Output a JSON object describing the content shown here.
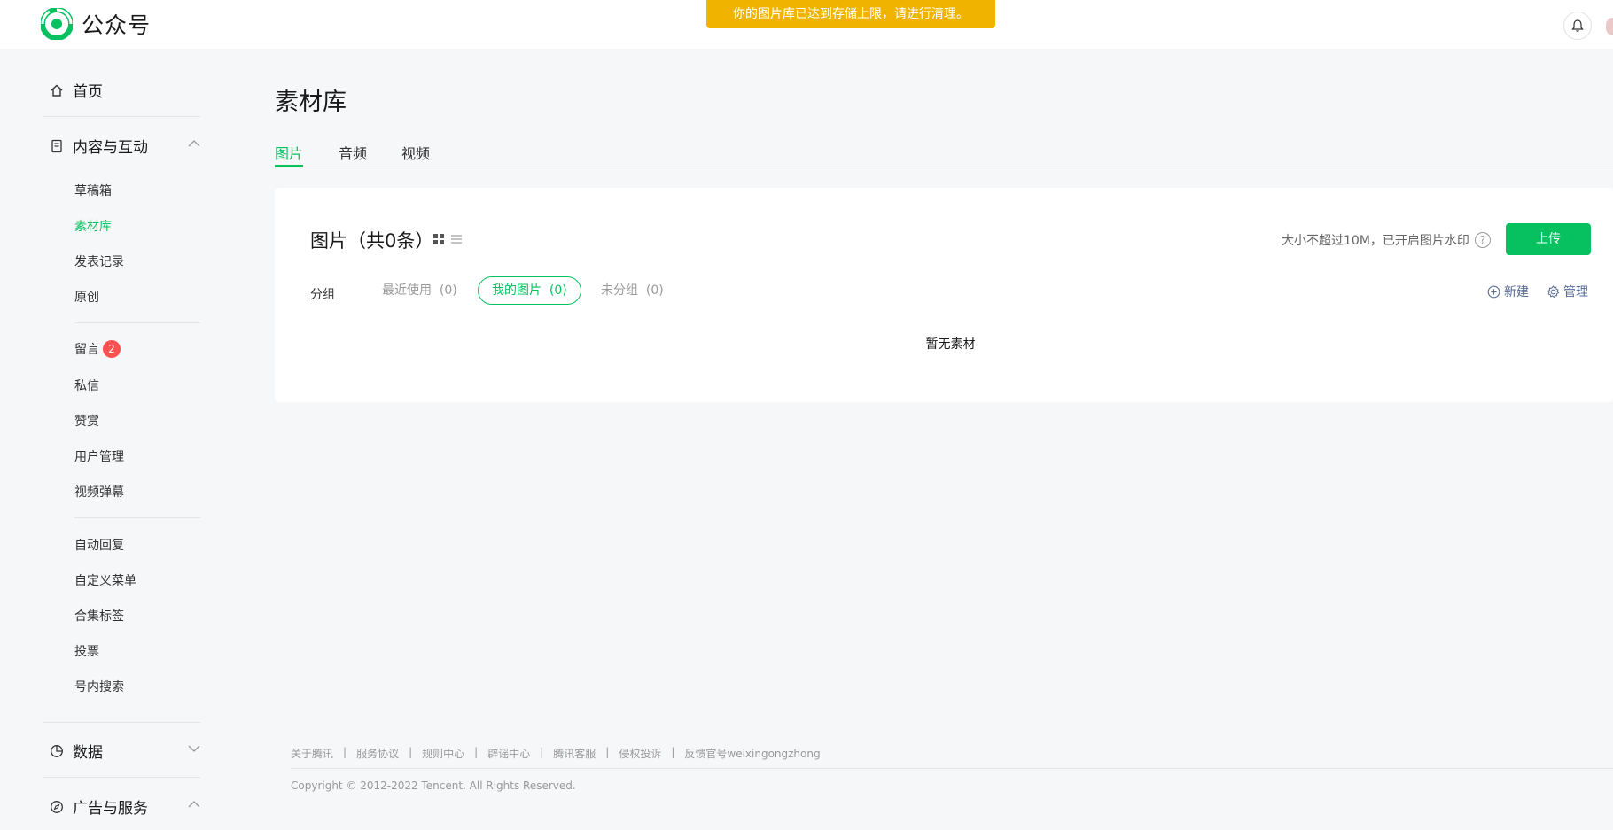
{
  "header": {
    "app_name": "公众号",
    "notice": "你的图片库已达到存储上限，请进行清理。",
    "icons": {
      "logo": "wechat-oa-logo",
      "bell": "bell-icon"
    }
  },
  "sidebar": {
    "home": "首页",
    "content_section": "内容与互动",
    "content_items": [
      "草稿箱",
      "素材库",
      "发表记录",
      "原创"
    ],
    "interact_items": {
      "comments": "留言",
      "comments_badge": "2",
      "messages": "私信",
      "rewards": "赞赏",
      "users": "用户管理",
      "danmaku": "视频弹幕"
    },
    "other_items": [
      "自动回复",
      "自定义菜单",
      "合集标签",
      "投票",
      "号内搜索"
    ],
    "data_section": "数据",
    "ads_section": "广告与服务",
    "active_item": "素材库"
  },
  "main": {
    "title": "素材库",
    "tabs": [
      "图片",
      "音频",
      "视频"
    ],
    "active_tab": "图片",
    "card": {
      "title": "图片（共0条）",
      "upload_tip": "大小不超过10M，已开启图片水印",
      "upload_button": "上传",
      "group_label": "分组",
      "groups": [
        "最近使用",
        "我的图片",
        "未分组"
      ],
      "group_counts": [
        "(0)",
        "(0)",
        "(0)"
      ],
      "active_group": "我的图片",
      "new_label": "新建",
      "manage_label": "管理",
      "empty_text": "暂无素材"
    }
  },
  "footer": {
    "links": [
      "关于腾讯",
      "服务协议",
      "规则中心",
      "辟谣中心",
      "腾讯客服",
      "侵权投诉",
      "反馈官号weixingongzhong"
    ],
    "copyright": "Copyright © 2012-2022 Tencent. All Rights Reserved."
  },
  "colors": {
    "accent": "#07c160",
    "notice": "#f0b400",
    "badge": "#fa5151",
    "link": "#576b95"
  }
}
